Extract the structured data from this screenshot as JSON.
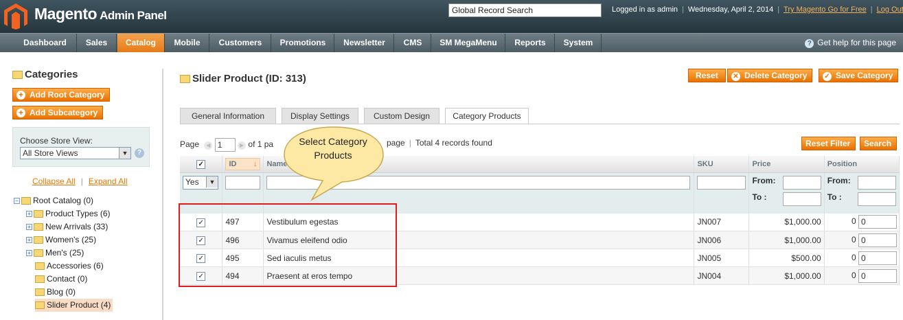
{
  "header": {
    "brand": "Magento",
    "brand_sub": "Admin Panel",
    "global_search": "Global Record Search",
    "logged_in": "Logged in as admin",
    "date": "Wednesday, April 2, 2014",
    "try_link": "Try Magento Go for Free",
    "logout": "Log Out"
  },
  "nav": {
    "items": [
      "Dashboard",
      "Sales",
      "Catalog",
      "Mobile",
      "Customers",
      "Promotions",
      "Newsletter",
      "CMS",
      "SM MegaMenu",
      "Reports",
      "System"
    ],
    "active": "Catalog",
    "help": "Get help for this page"
  },
  "sidebar": {
    "title": "Categories",
    "add_root": "Add Root Category",
    "add_sub": "Add Subcategory",
    "store_label": "Choose Store View:",
    "store_value": "All Store Views",
    "collapse": "Collapse All",
    "expand": "Expand All",
    "sep": "|",
    "tree": [
      {
        "label": "Root Catalog (0)"
      },
      {
        "label": "Product Types (6)"
      },
      {
        "label": "New Arrivals (33)"
      },
      {
        "label": "Women's (25)"
      },
      {
        "label": "Men's (25)"
      },
      {
        "label": "Accessories (6)"
      },
      {
        "label": "Contact (0)"
      },
      {
        "label": "Blog (0)"
      },
      {
        "label": "Slider Product (4)"
      }
    ]
  },
  "main": {
    "title": "Slider Product (ID: 313)",
    "buttons": {
      "reset": "Reset",
      "delete": "Delete Category",
      "save": "Save Category"
    },
    "tabs": [
      "General Information",
      "Display Settings",
      "Custom Design",
      "Category Products"
    ],
    "pager": {
      "page_label": "Page",
      "page_value": "1",
      "of_pages": "of 1 pa",
      "page_suffix": "page",
      "total": "Total 4 records found",
      "reset_filter": "Reset Filter",
      "search": "Search"
    },
    "columns": [
      "ID",
      "Name",
      "SKU",
      "Price",
      "Position"
    ],
    "filter": {
      "yes": "Yes",
      "from": "From:",
      "to": "To :"
    },
    "rows": [
      {
        "id": "497",
        "name": "Vestibulum egestas",
        "sku": "JN007",
        "price": "$1,000.00",
        "pos_text": "0",
        "pos_input": "0"
      },
      {
        "id": "496",
        "name": "Vivamus eleifend odio",
        "sku": "JN006",
        "price": "$1,000.00",
        "pos_text": "0",
        "pos_input": "0"
      },
      {
        "id": "495",
        "name": "Sed iaculis metus",
        "sku": "JN005",
        "price": "$500.00",
        "pos_text": "0",
        "pos_input": "0"
      },
      {
        "id": "494",
        "name": "Praesent at eros tempo",
        "sku": "JN004",
        "price": "$1,000.00",
        "pos_text": "0",
        "pos_input": "0"
      }
    ],
    "callout": "Select Category Products"
  },
  "colors": {
    "accent": "#eb5e00",
    "header": "#2e3f47",
    "highlight": "#e01b1b"
  }
}
